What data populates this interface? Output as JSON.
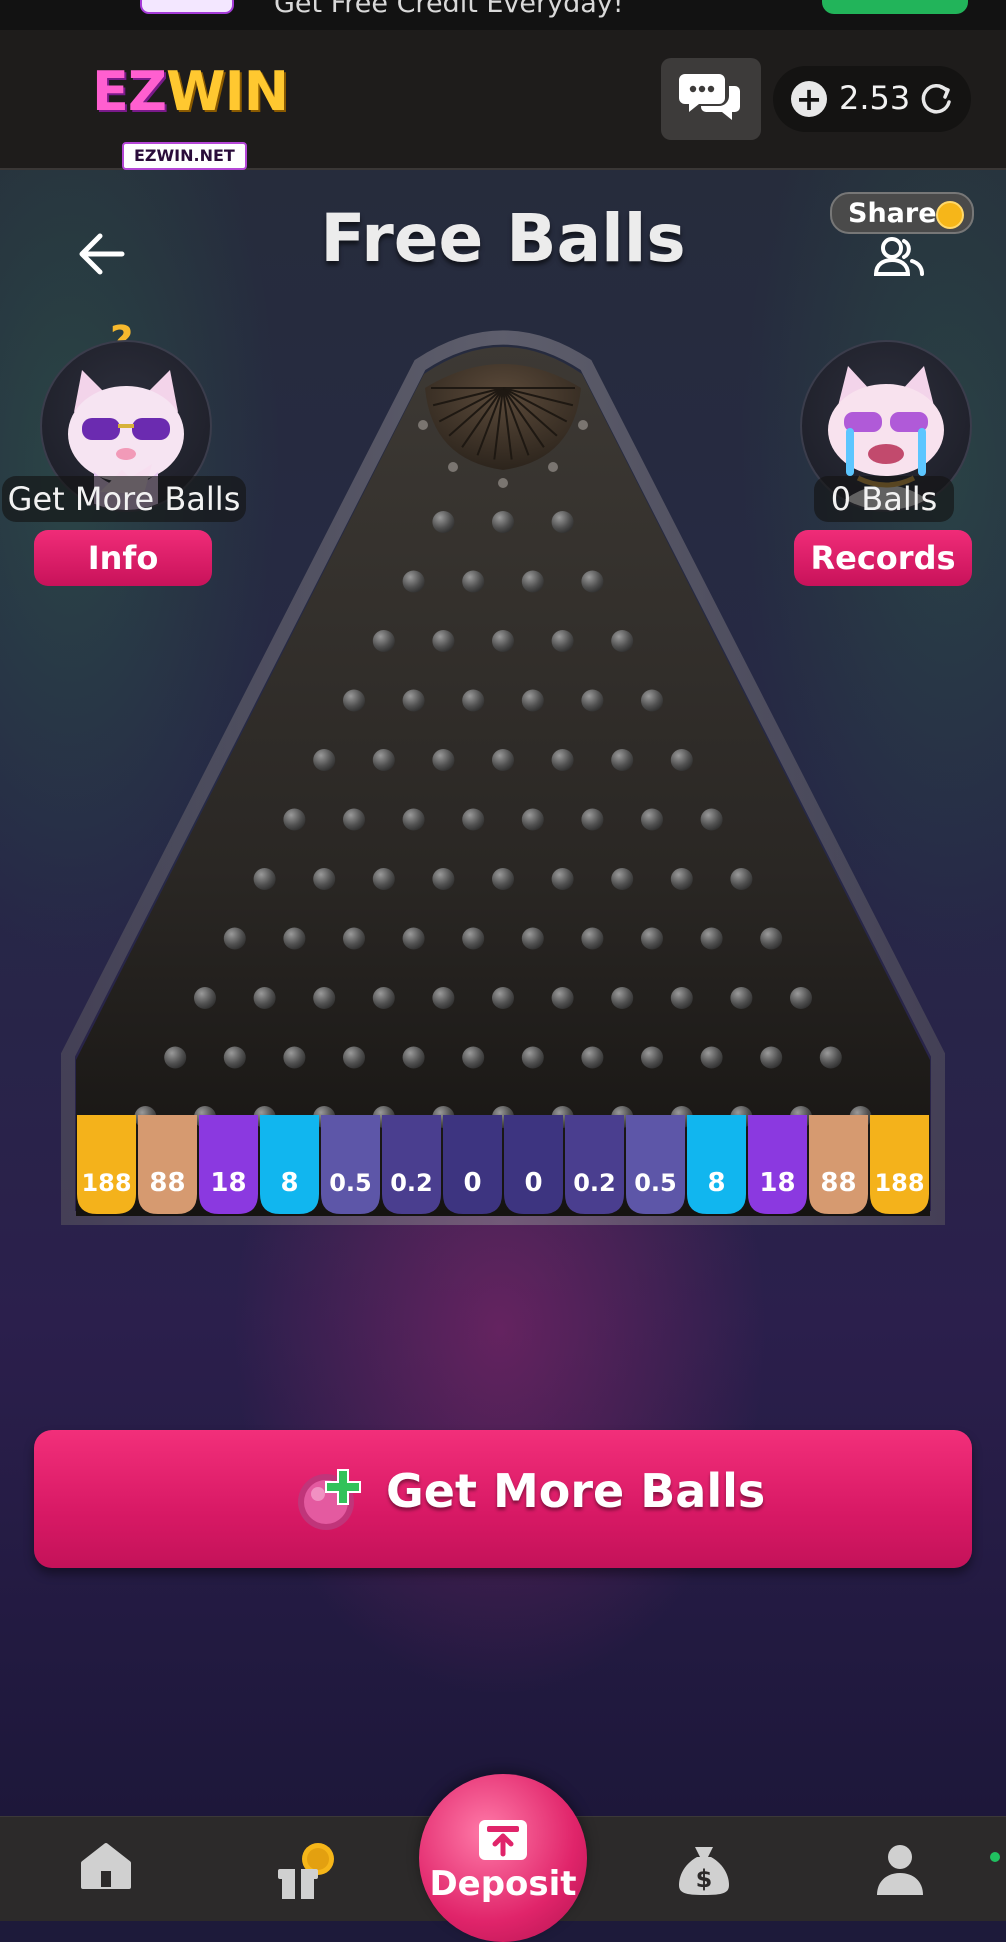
{
  "promo_bar": {
    "text": "Get Free Credit Everyday!"
  },
  "header": {
    "logo_main_ez": "EZ",
    "logo_main_win": "WIN",
    "logo_sub": "EZWIN.NET",
    "balance": "2.53"
  },
  "page": {
    "title": "Free Balls",
    "share_label": "Share"
  },
  "left_panel": {
    "hint_mark": "?",
    "label": "Get More Balls",
    "button": "Info"
  },
  "right_panel": {
    "label": "0 Balls",
    "button": "Records"
  },
  "board": {
    "rows": 10,
    "multipliers": [
      "188",
      "88",
      "18",
      "8",
      "0.5",
      "0.2",
      "0",
      "0",
      "0.2",
      "0.5",
      "8",
      "18",
      "88",
      "188"
    ],
    "slot_colors": [
      "#f4b21b",
      "#d69a70",
      "#8b39e0",
      "#11b6ef",
      "#5d56a8",
      "#4a3e8f",
      "#3d3480",
      "#3d3480",
      "#4a3e8f",
      "#5d56a8",
      "#11b6ef",
      "#8b39e0",
      "#d69a70",
      "#f4b21b"
    ]
  },
  "cta": {
    "label": "Get More Balls"
  },
  "nav": {
    "deposit": "Deposit"
  },
  "colors": {
    "accent_pink": "#e11e6a",
    "balance_bg": "#141312",
    "header_bg": "#1e1c1b"
  },
  "icons": {
    "back": "arrow-left-icon",
    "chat": "chat-bubbles-icon",
    "share": "users-icon",
    "refresh": "refresh-icon",
    "home": "home-icon",
    "promotion": "gift-icon",
    "earn": "money-bag-icon",
    "profile": "user-icon",
    "deposit": "wallet-icon"
  }
}
